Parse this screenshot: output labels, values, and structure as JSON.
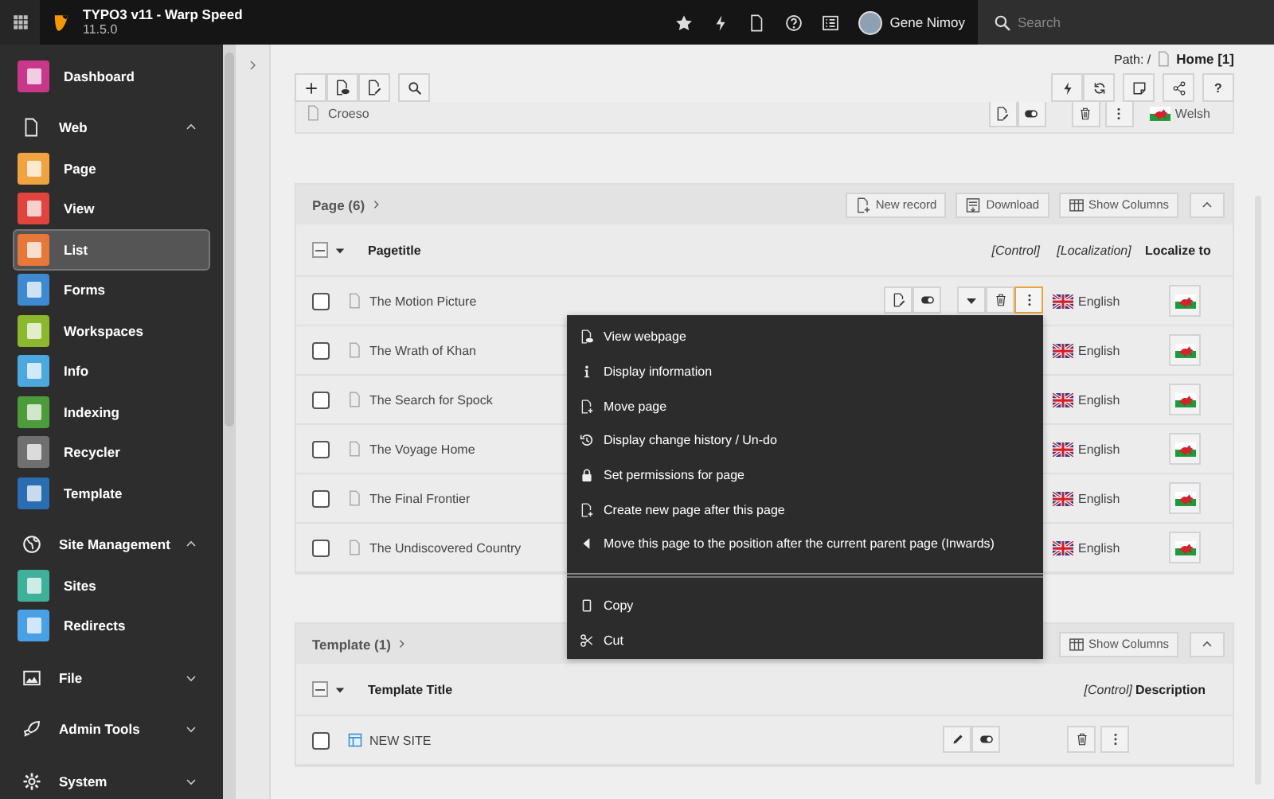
{
  "topbar": {
    "title": "TYPO3 v11 - Warp Speed",
    "version": "11.5.0",
    "user": "Gene Nimoy",
    "search": {
      "placeholder": "Search"
    }
  },
  "sidebar": {
    "items": [
      {
        "kind": "module",
        "label": "Dashboard",
        "color": "#c8378a",
        "selected": false
      },
      {
        "kind": "group",
        "label": "Web",
        "expanded": true,
        "children": [
          {
            "label": "Page",
            "color": "#f0a33f",
            "selected": false
          },
          {
            "label": "View",
            "color": "#e0443c",
            "selected": false
          },
          {
            "label": "List",
            "color": "#e8773a",
            "selected": true
          },
          {
            "label": "Forms",
            "color": "#3d8ad2",
            "selected": false
          },
          {
            "label": "Workspaces",
            "color": "#8cb82d",
            "selected": false
          },
          {
            "label": "Info",
            "color": "#4ba9df",
            "selected": false
          },
          {
            "label": "Indexing",
            "color": "#4c9c3c",
            "selected": false
          },
          {
            "label": "Recycler",
            "color": "#707070",
            "selected": false
          },
          {
            "label": "Template",
            "color": "#2b6db2",
            "selected": false
          }
        ]
      },
      {
        "kind": "group",
        "label": "Site Management",
        "expanded": true,
        "children": [
          {
            "label": "Sites",
            "color": "#3fb19b",
            "selected": false
          },
          {
            "label": "Redirects",
            "color": "#4aa0e5",
            "selected": false
          }
        ]
      },
      {
        "kind": "group",
        "label": "File",
        "expanded": false
      },
      {
        "kind": "group",
        "label": "Admin Tools",
        "expanded": false
      },
      {
        "kind": "group",
        "label": "System",
        "expanded": false
      }
    ]
  },
  "path": {
    "label": "Path: /",
    "page": "Home [1]"
  },
  "doc_toolbar": {
    "help": "?"
  },
  "croeso_row": {
    "title": "Croeso",
    "language": "Welsh"
  },
  "page_table": {
    "title": "Page (6)",
    "select_all_partial": true,
    "buttons": [
      "New record",
      "Download",
      "Show Columns"
    ],
    "columns": [
      "Pagetitle",
      "[Control]",
      "[Localization]",
      "Localize to"
    ],
    "rows": [
      {
        "title": "The Motion Picture",
        "language": "English",
        "checked": false,
        "controls": {
          "menu_open": true
        }
      },
      {
        "title": "The Wrath of Khan",
        "language": "English",
        "checked": false
      },
      {
        "title": "The Search for Spock",
        "language": "English",
        "checked": false
      },
      {
        "title": "The Voyage Home",
        "language": "English",
        "checked": false
      },
      {
        "title": "The Final Frontier",
        "language": "English",
        "checked": false
      },
      {
        "title": "The Undiscovered Country",
        "language": "English",
        "checked": false
      }
    ]
  },
  "template_table": {
    "title": "Template (1)",
    "select_all_partial": true,
    "buttons": [
      "Show Columns"
    ],
    "columns": [
      "Template Title",
      "[Control]",
      "Description"
    ],
    "rows": [
      {
        "title": "NEW SITE",
        "checked": false
      }
    ]
  },
  "context_menu": {
    "groups": [
      [
        "View webpage",
        "Display information",
        "Move page",
        "Display change history / Un-do",
        "Set permissions for page",
        "Create new page after this page",
        "Move this page to the position after the current parent page (Inwards)"
      ],
      [
        "Copy",
        "Cut"
      ]
    ]
  }
}
